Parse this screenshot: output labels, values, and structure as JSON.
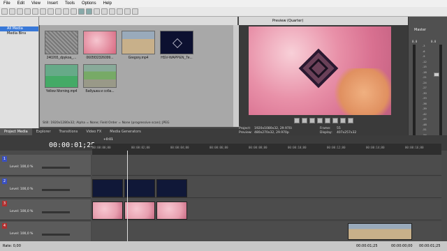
{
  "menu": [
    "File",
    "Edit",
    "View",
    "Insert",
    "Tools",
    "Options",
    "Help"
  ],
  "tree": {
    "items": [
      "All Media",
      "Media Bins"
    ]
  },
  "media": {
    "thumbs": [
      {
        "label": "240265_dpykoa_..."
      },
      {
        "label": "0605f32326099..."
      },
      {
        "label": "Gregory.mp4"
      },
      {
        "label": "HSV-WAPPEN_Te..."
      },
      {
        "label": "Yellow Morning.mp4"
      },
      {
        "label": "Бабушка и соба..."
      }
    ],
    "info": "Still: 1920x1280x32; Alpha = None; Field Order = None (progressive scan); JPEG"
  },
  "tabs": [
    "Project Media",
    "Explorer",
    "Transitions",
    "Video FX",
    "Media Generators"
  ],
  "preview": {
    "quality": "Preview (Quarter)",
    "project_label": "Project:",
    "project": "1920x1080x32, 29.970i",
    "preview_label": "Preview:",
    "preview_val": "480x270x32, 29.970p",
    "frame_label": "Frame:",
    "frame": "55",
    "display_label": "Display:",
    "display": "407x257x32"
  },
  "master": {
    "title": "Master",
    "scale": [
      "-3",
      "-6",
      "-9",
      "-12",
      "-15",
      "-18",
      "-21",
      "-24",
      "-27",
      "-30",
      "-33",
      "-36",
      "-39",
      "-42",
      "-45",
      "-48",
      "-51",
      "-54",
      "-57"
    ],
    "vals": [
      "0.0",
      "0.0"
    ]
  },
  "timeline": {
    "timecode": "00:00:01;25",
    "marker": "+0:01",
    "ruler": [
      "00:00:00;00",
      "00:00:02;00",
      "00:00:04;00",
      "00:00:06;00",
      "00:00:08;00",
      "00:00:10;00",
      "00:00:12;00",
      "00:00:14;00",
      "00:00:16;00"
    ],
    "tracks": [
      {
        "num": "1",
        "level": "Level: 100,0 %"
      },
      {
        "num": "2",
        "level": "Level: 100,0 %"
      },
      {
        "num": "3",
        "level": "Level: 100,0 %"
      },
      {
        "num": "4",
        "level": "Level: 100,0 %"
      }
    ]
  },
  "status": {
    "rate": "Rate: 0,00",
    "time_a": "00:00:01;25",
    "time_b": "00:00:00;00",
    "time_c": "00:00:01;25"
  },
  "colors": {
    "accent": "#3878d8",
    "pink": "#e8a0b0",
    "navy": "#101838"
  }
}
